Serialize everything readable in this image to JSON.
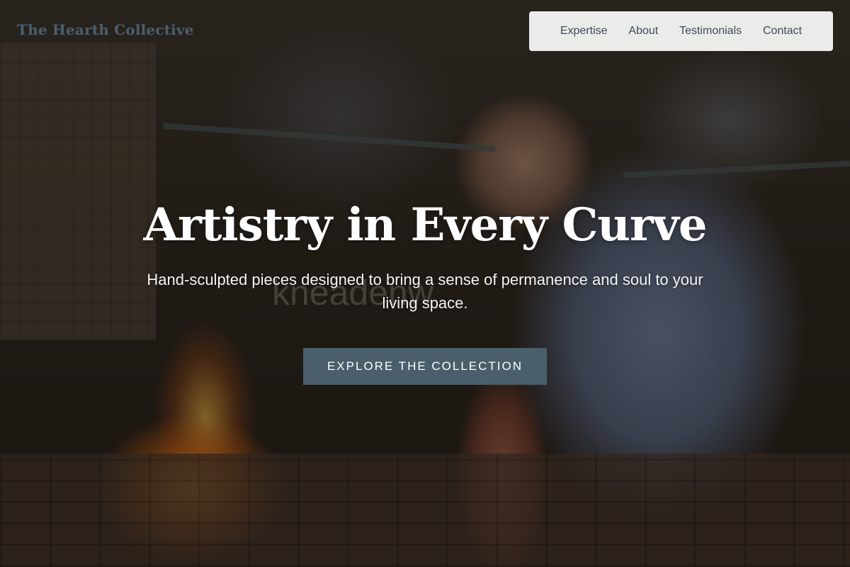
{
  "brand": {
    "name": "The Hearth Collective"
  },
  "nav": {
    "items": [
      {
        "label": "Expertise"
      },
      {
        "label": "About"
      },
      {
        "label": "Testimonials"
      },
      {
        "label": "Contact"
      }
    ]
  },
  "hero": {
    "headline": "Artistry in Every Curve",
    "subheadline": "Hand-sculpted pieces designed to bring a sense of permanence and soul to your living space.",
    "background_watermark": "kneadenw",
    "cta_label": "EXPLORE THE COLLECTION"
  },
  "colors": {
    "accent": "#4a5f6b",
    "brand_text": "#4a5f6e",
    "nav_background": "#ebebea",
    "nav_text": "#3d4c57",
    "headline_text": "#ffffff"
  }
}
